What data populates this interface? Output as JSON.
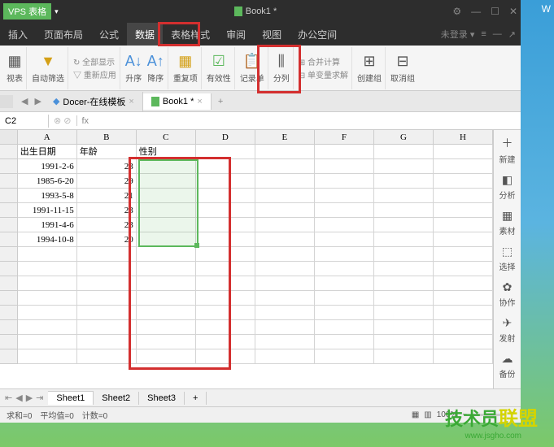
{
  "titlebar": {
    "app_name": "VPS 表格",
    "doc_title": "Book1 *",
    "win_min": "—",
    "win_max": "☐",
    "win_close": "✕"
  },
  "menubar": {
    "items": [
      "插入",
      "页面布局",
      "公式",
      "数据",
      "表格样式",
      "审阅",
      "视图",
      "办公空间"
    ],
    "active_index": 3,
    "login": "未登录 ▾",
    "menu_icon": "≡",
    "minus": "—",
    "wrench": "↗"
  },
  "toolbar": {
    "pivot": "视表",
    "autofilter": "自动筛选",
    "showall": "全部显示",
    "reapply": "重新应用",
    "sort_asc": "升序",
    "sort_desc": "降序",
    "duplicates": "重复项",
    "validation": "有效性",
    "form": "记录单",
    "texttocol": "分列",
    "consolidate": "合并计算",
    "whatif": "单变量求解",
    "group": "创建组",
    "ungroup": "取消组"
  },
  "doctabs": {
    "template": "Docer-在线模板",
    "book": "Book1 *",
    "add": "+"
  },
  "formula": {
    "namebox": "C2",
    "fx": "fx"
  },
  "columns": [
    "A",
    "B",
    "C",
    "D",
    "E",
    "F",
    "G",
    "H"
  ],
  "headers": {
    "a": "出生日期",
    "b": "年龄",
    "c": "性别"
  },
  "rows": [
    {
      "a": "1991-2-6",
      "b": "23"
    },
    {
      "a": "1985-6-20",
      "b": "29"
    },
    {
      "a": "1993-5-8",
      "b": "21"
    },
    {
      "a": "1991-11-15",
      "b": "23"
    },
    {
      "a": "1991-4-6",
      "b": "23"
    },
    {
      "a": "1994-10-8",
      "b": "20"
    }
  ],
  "rightpanel": {
    "new": "新建",
    "analyze": "分析",
    "material": "素材",
    "select": "选择",
    "collab": "协作",
    "share": "发射",
    "backup": "备份"
  },
  "sheets": {
    "nav": [
      "⇤",
      "◀",
      "▶",
      "⇥"
    ],
    "tabs": [
      "Sheet1",
      "Sheet2",
      "Sheet3"
    ],
    "add": "+"
  },
  "statusbar": {
    "sum": "求和=0",
    "avg": "平均值=0",
    "count": "计数=0",
    "zoom": "100%"
  },
  "watermark": {
    "main1": "技术员",
    "main2": "联盟",
    "sub": "www.jsgho.com"
  },
  "extra": "W"
}
